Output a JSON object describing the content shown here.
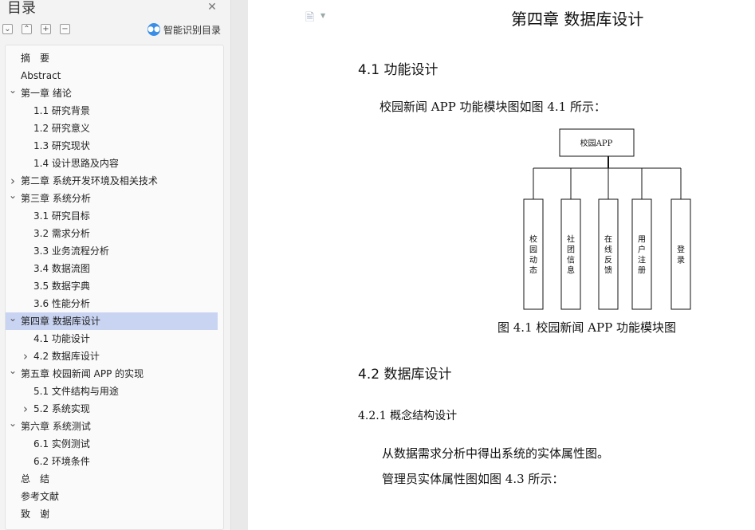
{
  "outline": {
    "title": "目录",
    "smart_button_label": "智能识别目录",
    "toolbar_icons": [
      "collapse-all-icon",
      "expand-up-icon",
      "add-icon",
      "remove-icon"
    ],
    "items": [
      {
        "text": "摘　要",
        "level": 0,
        "toggle": ""
      },
      {
        "text": "Abstract",
        "level": 0,
        "toggle": ""
      },
      {
        "text": "第一章  绪论",
        "level": 0,
        "toggle": "expanded"
      },
      {
        "text": "1.1  研究背景",
        "level": 1,
        "toggle": ""
      },
      {
        "text": "1.2  研究意义",
        "level": 1,
        "toggle": ""
      },
      {
        "text": "1.3 研究现状",
        "level": 1,
        "toggle": ""
      },
      {
        "text": "1.4 设计思路及内容",
        "level": 1,
        "toggle": ""
      },
      {
        "text": "第二章  系统开发环境及相关技术",
        "level": 0,
        "toggle": "collapsed"
      },
      {
        "text": "第三章  系统分析",
        "level": 0,
        "toggle": "expanded"
      },
      {
        "text": "3.1  研究目标",
        "level": 1,
        "toggle": ""
      },
      {
        "text": "3.2  需求分析",
        "level": 1,
        "toggle": ""
      },
      {
        "text": "3.3 业务流程分析",
        "level": 1,
        "toggle": ""
      },
      {
        "text": "3.4 数据流图",
        "level": 1,
        "toggle": ""
      },
      {
        "text": "3.5 数据字典",
        "level": 1,
        "toggle": ""
      },
      {
        "text": "3.6 性能分析",
        "level": 1,
        "toggle": ""
      },
      {
        "text": "第四章  数据库设计",
        "level": 0,
        "toggle": "expanded",
        "selected": true
      },
      {
        "text": "4.1 功能设计",
        "level": 1,
        "toggle": ""
      },
      {
        "text": "4.2 数据库设计",
        "level": 1,
        "toggle": "collapsed"
      },
      {
        "text": "第五章  校园新闻 APP 的实现",
        "level": 0,
        "toggle": "expanded"
      },
      {
        "text": "5.1  文件结构与用途",
        "level": 1,
        "toggle": ""
      },
      {
        "text": "5.2  系统实现",
        "level": 1,
        "toggle": "collapsed"
      },
      {
        "text": "第六章  系统测试",
        "level": 0,
        "toggle": "expanded"
      },
      {
        "text": "6.1 实例测试",
        "level": 1,
        "toggle": ""
      },
      {
        "text": "6.2 环境条件",
        "level": 1,
        "toggle": ""
      },
      {
        "text": "总　结",
        "level": 0,
        "toggle": ""
      },
      {
        "text": "参考文献",
        "level": 0,
        "toggle": ""
      },
      {
        "text": "致　谢",
        "level": 0,
        "toggle": ""
      }
    ]
  },
  "document": {
    "chapter_title": "第四章  数据库设计",
    "h41": "4.1 功能设计",
    "intro": "校园新闻 APP 功能模块图如图 4.1 所示：",
    "figure": {
      "root": "校园APP",
      "modules": [
        "校园动态",
        "社团信息",
        "在线反馈",
        "用户注册",
        "登录"
      ]
    },
    "figure_caption": "图 4.1  校园新闻 APP 功能模块图",
    "h42": "4.2 数据库设计",
    "h421": "4.2.1 概念结构设计",
    "para1": "从数据需求分析中得出系统的实体属性图。",
    "para2": "管理员实体属性图如图 4.3 所示："
  }
}
